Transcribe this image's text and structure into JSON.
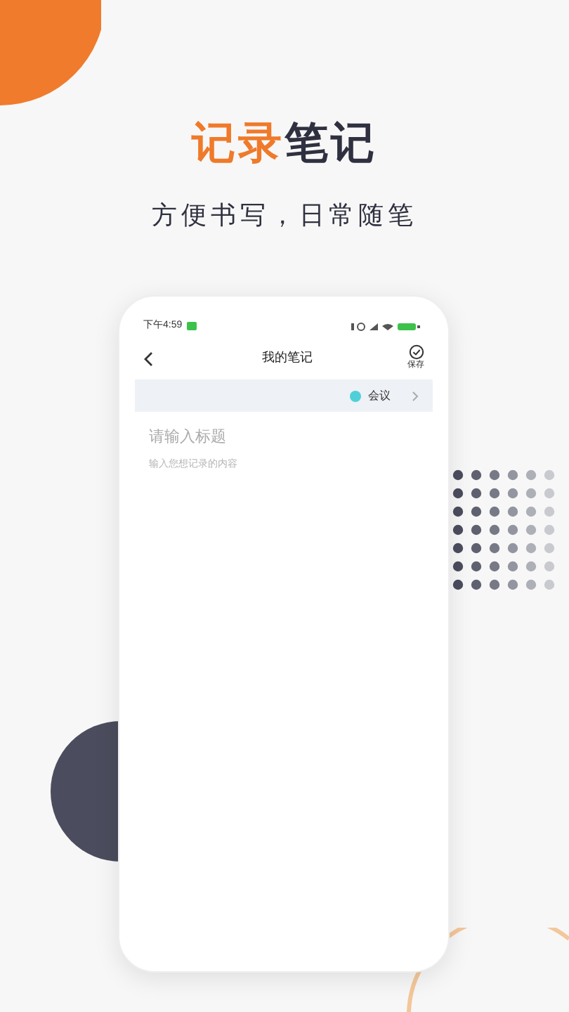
{
  "headline": {
    "accent": "记录",
    "rest": "笔记"
  },
  "subtitle": "方便书写，日常随笔",
  "phone": {
    "status_bar": {
      "time": "下午4:59"
    },
    "nav": {
      "title": "我的笔记",
      "save_label": "保存"
    },
    "category": {
      "label": "会议",
      "color": "#4fd0d8"
    },
    "title_field": {
      "placeholder": "请输入标题"
    },
    "content_field": {
      "placeholder": "输入您想记录的内容"
    }
  }
}
